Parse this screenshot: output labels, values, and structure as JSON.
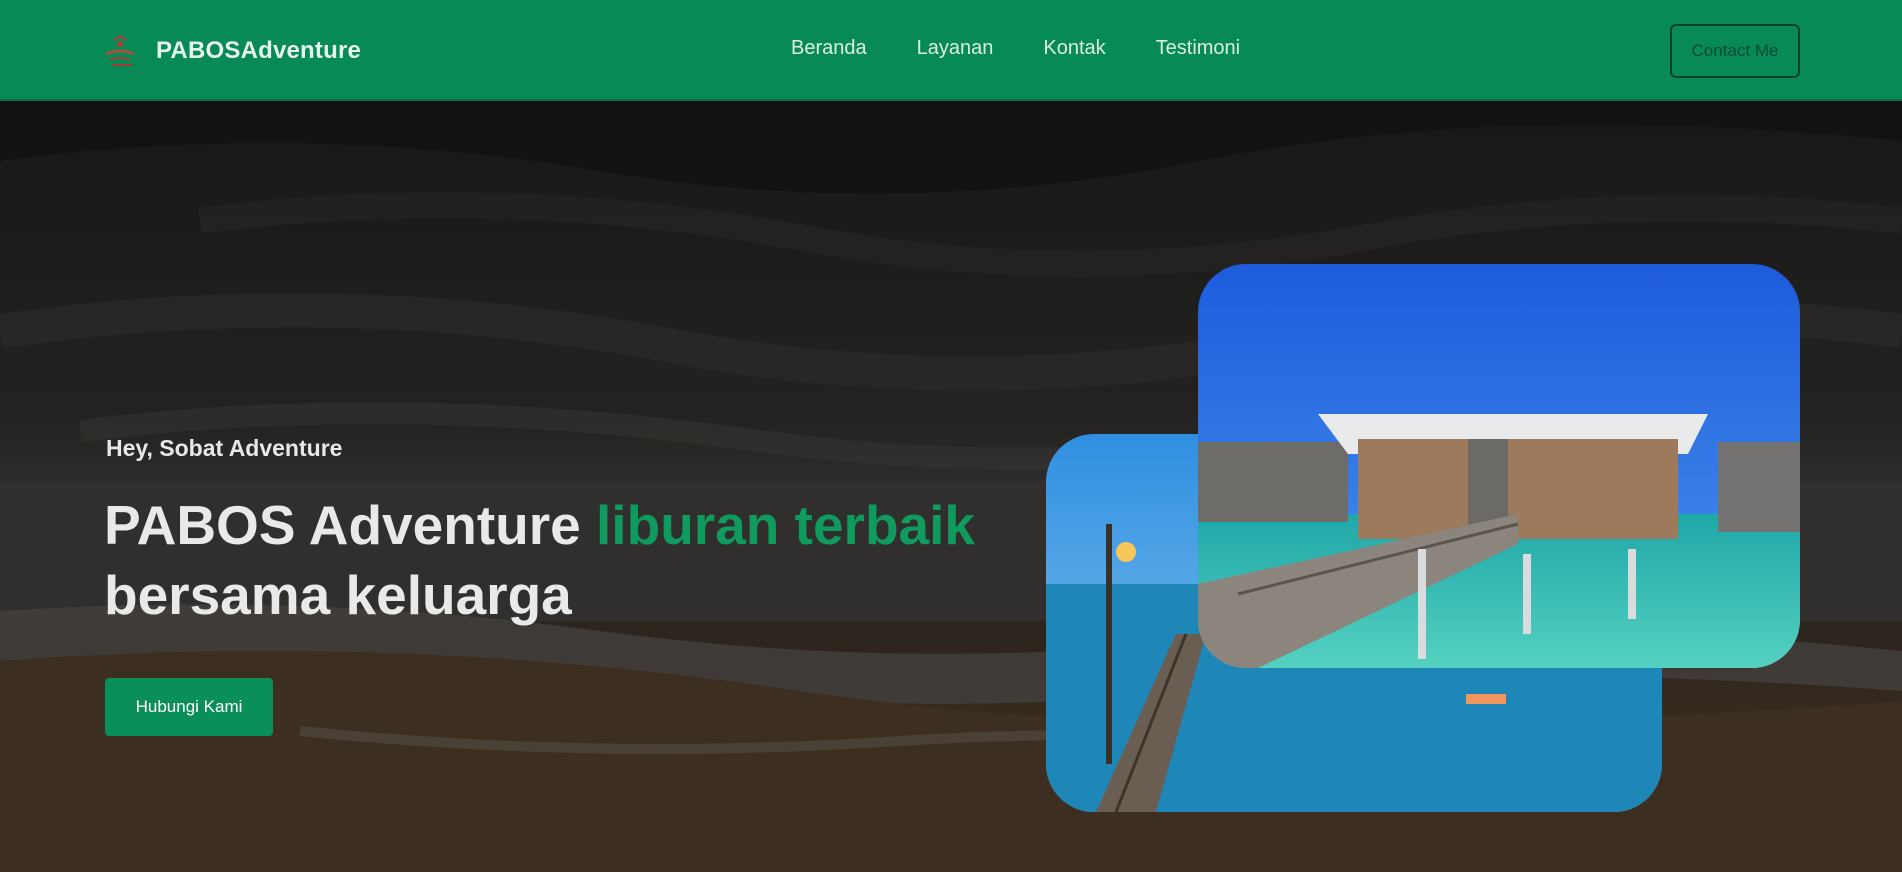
{
  "brand": {
    "name": "PABOSAdventure",
    "logo_icon": "travel-logo-icon"
  },
  "nav": {
    "links": [
      "Beranda",
      "Layanan",
      "Kontak",
      "Testimoni"
    ]
  },
  "header": {
    "contact_label": "Contact Me"
  },
  "hero": {
    "greeting": "Hey, Sobat Adventure",
    "headline_part1": "PABOS Adventure ",
    "headline_accent": "liburan terbaik",
    "headline_part2": "bersama keluarga",
    "cta_label": "Hubungi Kami"
  },
  "colors": {
    "brand_green": "#078a56",
    "accent_green": "#0f9a5e",
    "button_green": "#0b8f58"
  }
}
